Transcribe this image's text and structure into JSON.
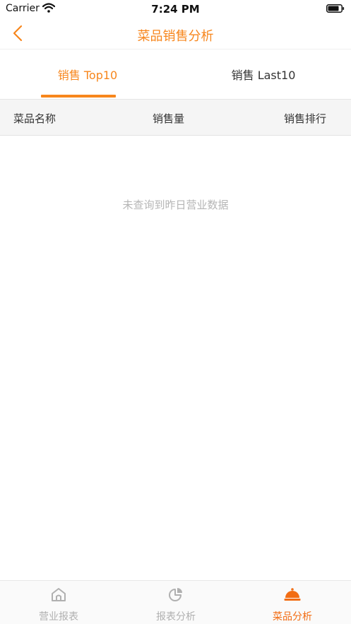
{
  "status_bar": {
    "carrier": "Carrier",
    "time": "7:24 PM"
  },
  "nav": {
    "title": "菜品销售分析",
    "back_icon": "chevron-left-icon"
  },
  "tabs": [
    {
      "label": "销售 Top10",
      "selected": true
    },
    {
      "label": "销售 Last10",
      "selected": false
    }
  ],
  "table": {
    "columns": [
      "菜品名称",
      "销售量",
      "销售排行"
    ]
  },
  "empty_message": "未查询到昨日营业数据",
  "tab_bar": [
    {
      "label": "营业报表",
      "icon": "home-icon",
      "selected": false
    },
    {
      "label": "报表分析",
      "icon": "pie-chart-icon",
      "selected": false
    },
    {
      "label": "菜品分析",
      "icon": "service-bell-icon",
      "selected": true
    }
  ],
  "colors": {
    "accent": "#f7861c",
    "active_tab_bar": "#f26d14",
    "inactive": "#b0b0b0"
  }
}
